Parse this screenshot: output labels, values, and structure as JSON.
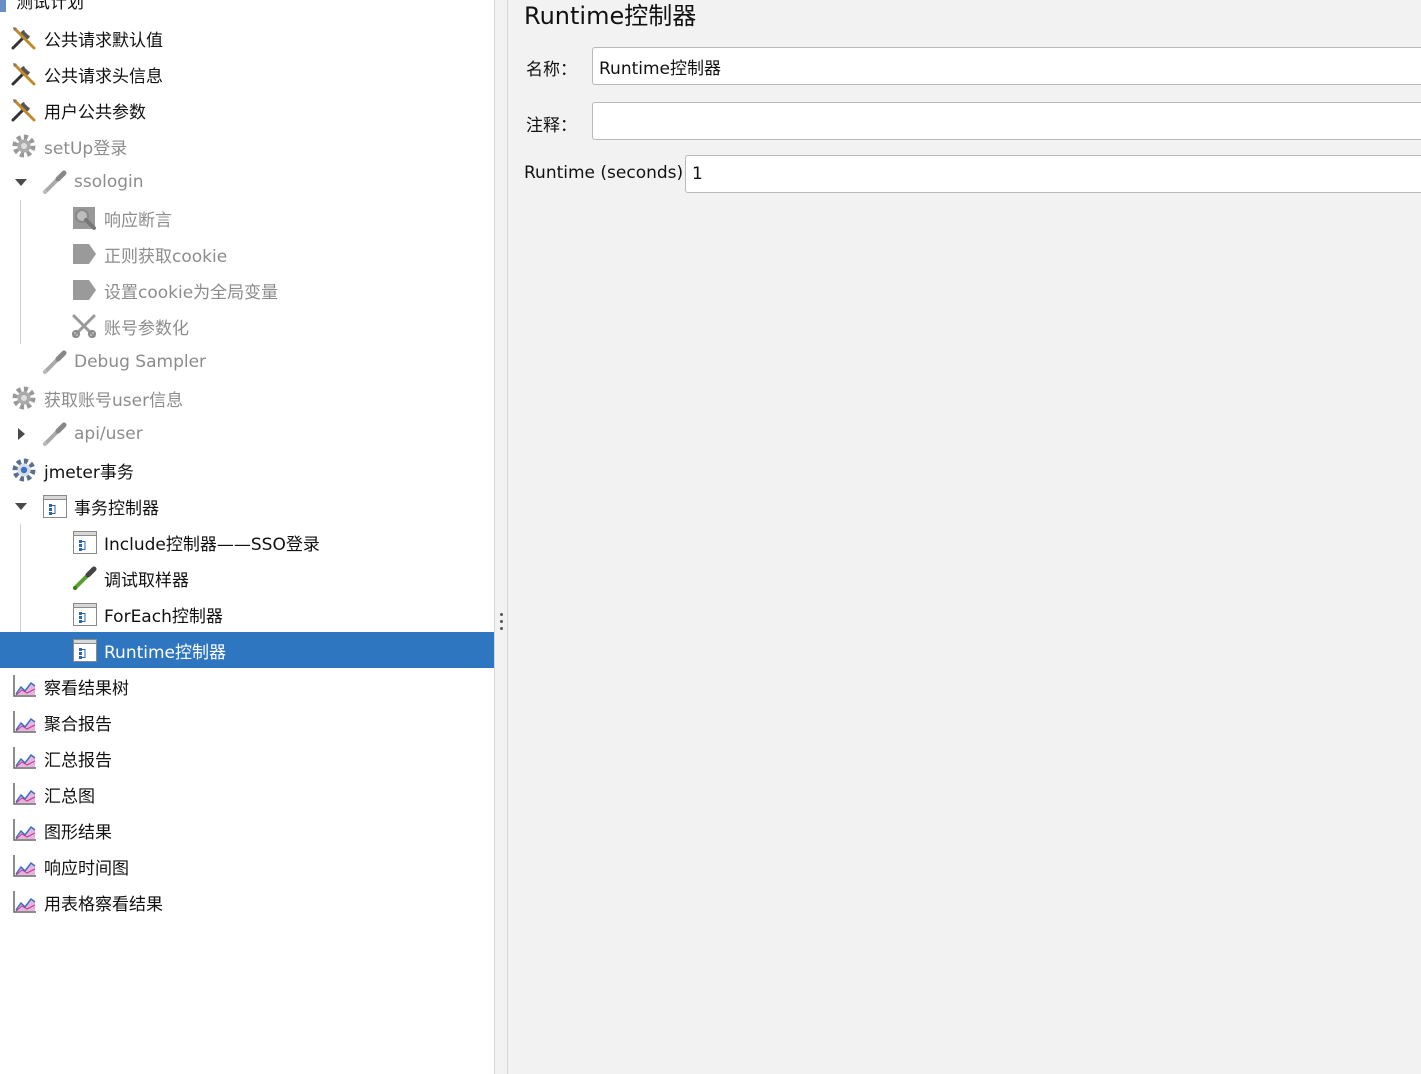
{
  "tree": {
    "items": [
      {
        "label": "测试计划"
      },
      {
        "label": "公共请求默认值"
      },
      {
        "label": "公共请求头信息"
      },
      {
        "label": "用户公共参数"
      },
      {
        "label": "setUp登录"
      },
      {
        "label": "ssologin"
      },
      {
        "label": "响应断言"
      },
      {
        "label": "正则获取cookie"
      },
      {
        "label": "设置cookie为全局变量"
      },
      {
        "label": "账号参数化"
      },
      {
        "label": "Debug Sampler"
      },
      {
        "label": "获取账号user信息"
      },
      {
        "label": "api/user"
      },
      {
        "label": "jmeter事务"
      },
      {
        "label": "事务控制器"
      },
      {
        "label": "Include控制器——SSO登录"
      },
      {
        "label": "调试取样器"
      },
      {
        "label": "ForEach控制器"
      },
      {
        "label": "Runtime控制器"
      },
      {
        "label": "察看结果树"
      },
      {
        "label": "聚合报告"
      },
      {
        "label": "汇总报告"
      },
      {
        "label": "汇总图"
      },
      {
        "label": "图形结果"
      },
      {
        "label": "响应时间图"
      },
      {
        "label": "用表格察看结果"
      }
    ]
  },
  "editor": {
    "title": "Runtime控制器",
    "name_label": "名称：",
    "name_value": "Runtime控制器",
    "comment_label": "注释：",
    "comment_value": "",
    "runtime_label": "Runtime (seconds)",
    "runtime_value": "1"
  },
  "colors": {
    "selection": "#2f76c0",
    "editor_background": "#f2f2f2",
    "disabled_text": "#8c8c8c"
  }
}
